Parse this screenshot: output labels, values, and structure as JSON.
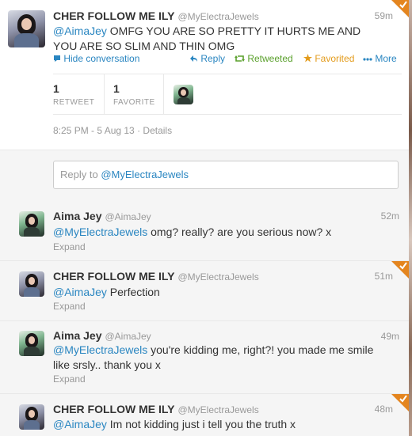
{
  "main_tweet": {
    "name": "CHER FOLLOW ME ILY",
    "handle": "@MyElectraJewels",
    "time": "59m",
    "mention": "@AimaJey",
    "text": " OMFG YOU ARE SO PRETTY IT HURTS ME AND YOU ARE SO SLIM AND THIN OMG",
    "actions": {
      "hide": "Hide conversation",
      "reply": "Reply",
      "retweeted": "Retweeted",
      "favorited": "Favorited",
      "more": "More"
    },
    "stats": {
      "retweets_count": "1",
      "retweets_label": "RETWEET",
      "favorites_count": "1",
      "favorites_label": "FAVORITE"
    },
    "timestamp": "8:25 PM - 5 Aug 13",
    "separator": " · ",
    "details": "Details"
  },
  "reply_box": {
    "prefix": "Reply to ",
    "mention": "@MyElectraJewels"
  },
  "replies": [
    {
      "name": "Aima Jey",
      "handle": "@AimaJey",
      "time": "52m",
      "mention": "@MyElectraJewels",
      "text": " omg? really? are you serious now? x",
      "expand": "Expand"
    },
    {
      "name": "CHER FOLLOW ME ILY",
      "handle": "@MyElectraJewels",
      "time": "51m",
      "mention": "@AimaJey",
      "text": " Perfection",
      "expand": "Expand"
    },
    {
      "name": "Aima Jey",
      "handle": "@AimaJey",
      "time": "49m",
      "mention": "@MyElectraJewels",
      "text": " you're kidding me, right?! you made me smile like srsly.. thank you x",
      "expand": "Expand"
    },
    {
      "name": "CHER FOLLOW ME ILY",
      "handle": "@MyElectraJewels",
      "time": "48m",
      "mention": "@AimaJey",
      "text": " Im not kidding just i tell you the truth x"
    }
  ],
  "colors": {
    "link": "#2a86c1",
    "retweeted": "#5aa02c",
    "favorited": "#e39b1b",
    "corner_badge": "#e4851f"
  },
  "icons": [
    "bubble-icon",
    "reply-arrow-icon",
    "retweet-icon",
    "star-icon",
    "more-dots-icon",
    "retweet-favorite-corner-icon"
  ]
}
